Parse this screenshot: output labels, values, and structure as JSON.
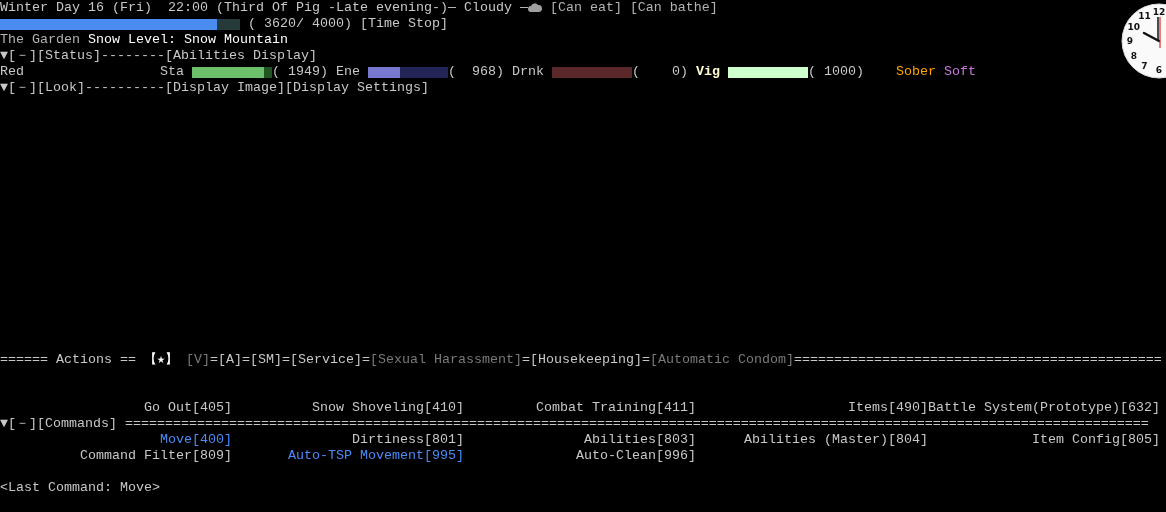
{
  "header": {
    "text": "Winter Day 16 (Fri)  22:00 (Third Of Pig -Late evening-)— Cloudy —",
    "buttons": [
      "[Can eat]",
      "[Can bathe]"
    ]
  },
  "time": {
    "level": 0.905,
    "reading": "( 3620/ 4000)",
    "button": "[Time Stop]"
  },
  "location": {
    "place": "The Garden",
    "snow": "Snow Level: Snow Mountain"
  },
  "status_header": {
    "toggle": "▼[－]",
    "label": "[Status]",
    "rule": "--------",
    "links": [
      "[Abilities Display]"
    ]
  },
  "character": {
    "name": "Red",
    "stats": [
      {
        "label": "Sta",
        "kind": "stamina",
        "level": 0.9,
        "reading": "( 1949)",
        "emphasis": false
      },
      {
        "label": "Ene",
        "kind": "energy",
        "level": 0.4,
        "reading": "(  968)",
        "emphasis": false
      },
      {
        "label": "Drnk",
        "kind": "drink",
        "level": 0,
        "reading": "(    0)",
        "emphasis": false
      },
      {
        "label": "Vig",
        "kind": "vigor",
        "level": 1,
        "reading": "( 1000)",
        "emphasis": true
      }
    ],
    "conditions": [
      {
        "label": "Sober",
        "color": "#ffa500"
      },
      {
        "label": "Soft",
        "color": "#c878e0"
      }
    ]
  },
  "look_header": {
    "toggle": "▼[－]",
    "label": "[Look]",
    "rule": "----------",
    "links": [
      "[Display Image]",
      "[Display Settings]"
    ]
  },
  "clock": {
    "numerals": [
      "12",
      "11",
      "10",
      "9",
      "8",
      "7",
      "6"
    ]
  },
  "actions": {
    "prefix": "====== Actions ==",
    "star": "【★】",
    "separator": "=",
    "tabs": [
      {
        "label": "[V]",
        "disabled": true
      },
      {
        "label": "[A]",
        "disabled": false
      },
      {
        "label": "[SM]",
        "disabled": false
      },
      {
        "label": "[Service]",
        "disabled": false
      },
      {
        "label": "[Sexual Harassment]",
        "disabled": true
      },
      {
        "label": "[Housekeeping]",
        "disabled": false
      },
      {
        "label": "[Automatic Condom]",
        "disabled": true
      }
    ],
    "trailing": "=============================================="
  },
  "commands_top": [
    {
      "label": "Go Out[405]",
      "highlighted": false
    },
    {
      "label": "Snow Shoveling[410]",
      "highlighted": false
    },
    {
      "label": "Combat Training[411]",
      "highlighted": false
    },
    {
      "label": "Items[490]",
      "highlighted": false
    },
    {
      "label": "Battle System(Prototype)[632]",
      "highlighted": false
    }
  ],
  "commands_header": {
    "toggle": "▼[－]",
    "label": "[Commands]",
    "rule": "================================================================================================================================"
  },
  "commands": [
    {
      "label": "Move[400]",
      "highlighted": true
    },
    {
      "label": "Dirtiness[801]",
      "highlighted": false
    },
    {
      "label": "Abilities[803]",
      "highlighted": false
    },
    {
      "label": "Abilities (Master)[804]",
      "highlighted": false
    },
    {
      "label": "Item Config[805]",
      "highlighted": false
    },
    {
      "label": "Command Filter[809]",
      "highlighted": false
    },
    {
      "label": "Auto-TSP Movement[995]",
      "highlighted": true
    },
    {
      "label": "Auto-Clean[996]",
      "highlighted": false
    }
  ],
  "last_command": "<Last Command: Move>"
}
